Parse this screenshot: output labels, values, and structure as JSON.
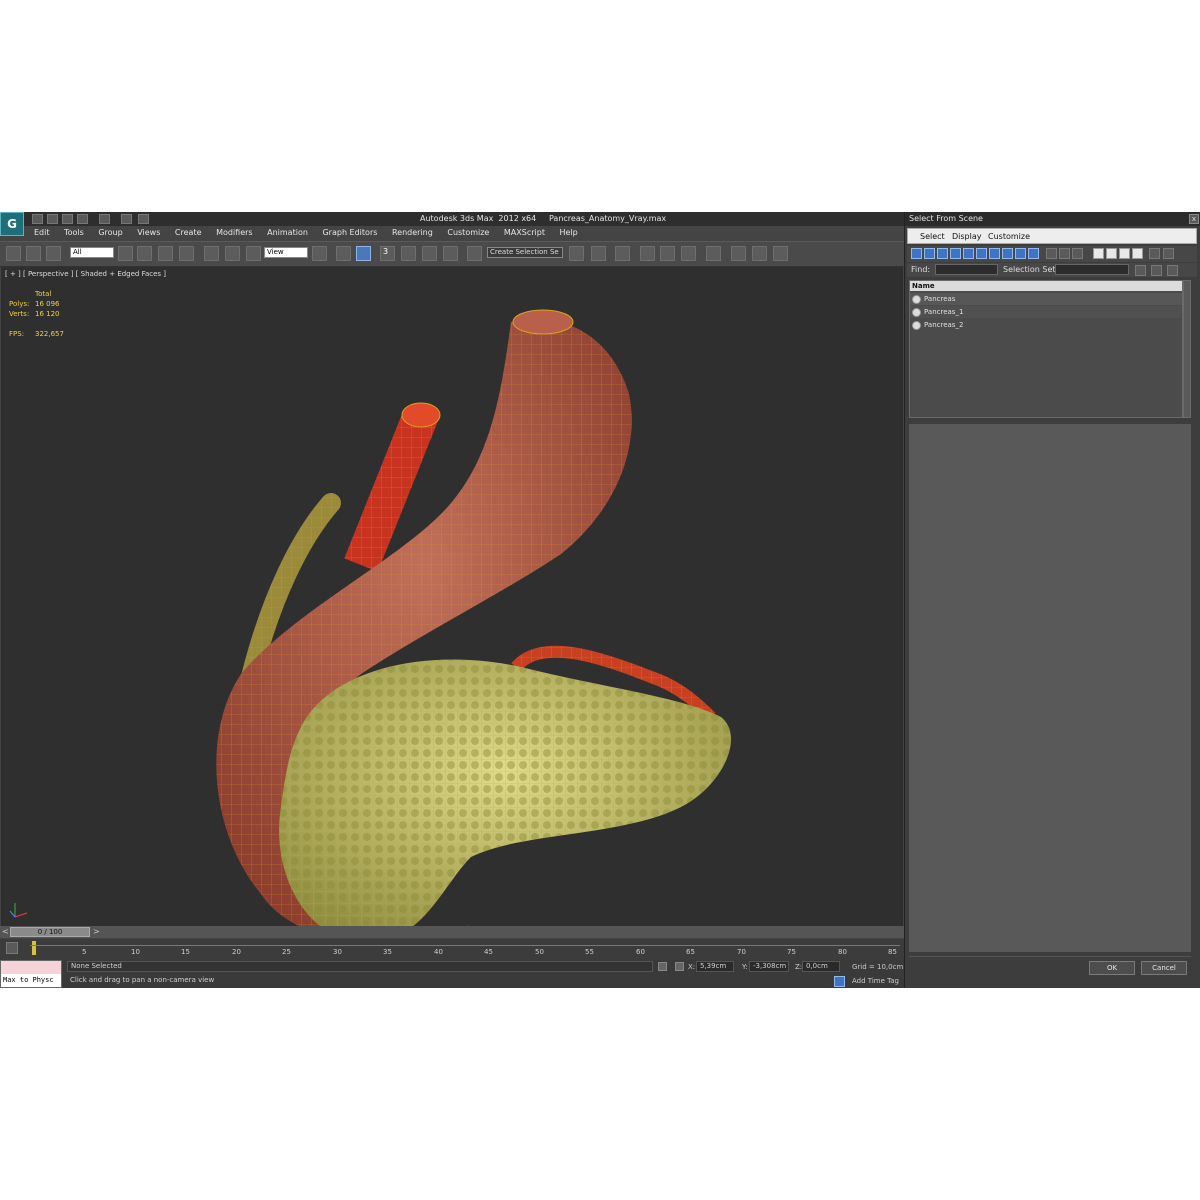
{
  "window": {
    "title": "Autodesk 3ds Max  2012 x64     Pancreas_Anatomy_Vray.max",
    "logo_text": "G"
  },
  "menu": [
    "Edit",
    "Tools",
    "Group",
    "Views",
    "Create",
    "Modifiers",
    "Animation",
    "Graph Editors",
    "Rendering",
    "Customize",
    "MAXScript",
    "Help"
  ],
  "toolbar": {
    "filter_value": "All",
    "refcoord_value": "View",
    "snap_label": "3",
    "named_selection_placeholder": "Create Selection Se"
  },
  "viewport": {
    "label": "[ + ] [ Perspective ] [ Shaded + Edged Faces ]",
    "stats": {
      "total_label": "Total",
      "polys_label": "Polys:",
      "polys_value": "16 096",
      "verts_label": "Verts:",
      "verts_value": "16 120",
      "fps_label": "FPS:",
      "fps_value": "322,657"
    }
  },
  "timeline": {
    "slider_label": "0 / 100",
    "ticks": [
      "5",
      "10",
      "15",
      "20",
      "25",
      "30",
      "35",
      "40",
      "45",
      "50",
      "55",
      "60",
      "65",
      "70",
      "75",
      "80",
      "85"
    ]
  },
  "status": {
    "maxscript_text": "Max to Physc",
    "selection": "None Selected",
    "prompt": "Click and drag to pan a non-camera view",
    "x_label": "X:",
    "x_value": "5,39cm",
    "y_label": "Y:",
    "y_value": "-3,308cm",
    "z_label": "Z:",
    "z_value": "0,0cm",
    "grid": "Grid = 10,0cm",
    "add_time_tag": "Add Time Tag"
  },
  "dialog": {
    "title": "Select From Scene",
    "close": "x",
    "menu": [
      "Select",
      "Display",
      "Customize"
    ],
    "find_label": "Find:",
    "selection_set_label": "Selection Set:",
    "column_name": "Name",
    "items": [
      "Pancreas",
      "Pancreas_1",
      "Pancreas_2"
    ],
    "ok": "OK",
    "cancel": "Cancel"
  },
  "colors": {
    "viewport_bg": "#2f2f2f",
    "stat_text": "#f2d23a",
    "stomach": "#a24c3b",
    "pancreas": "#b7b25a",
    "artery": "#c8331f",
    "duct": "#9a8a3a",
    "wire": "#e0a020"
  }
}
